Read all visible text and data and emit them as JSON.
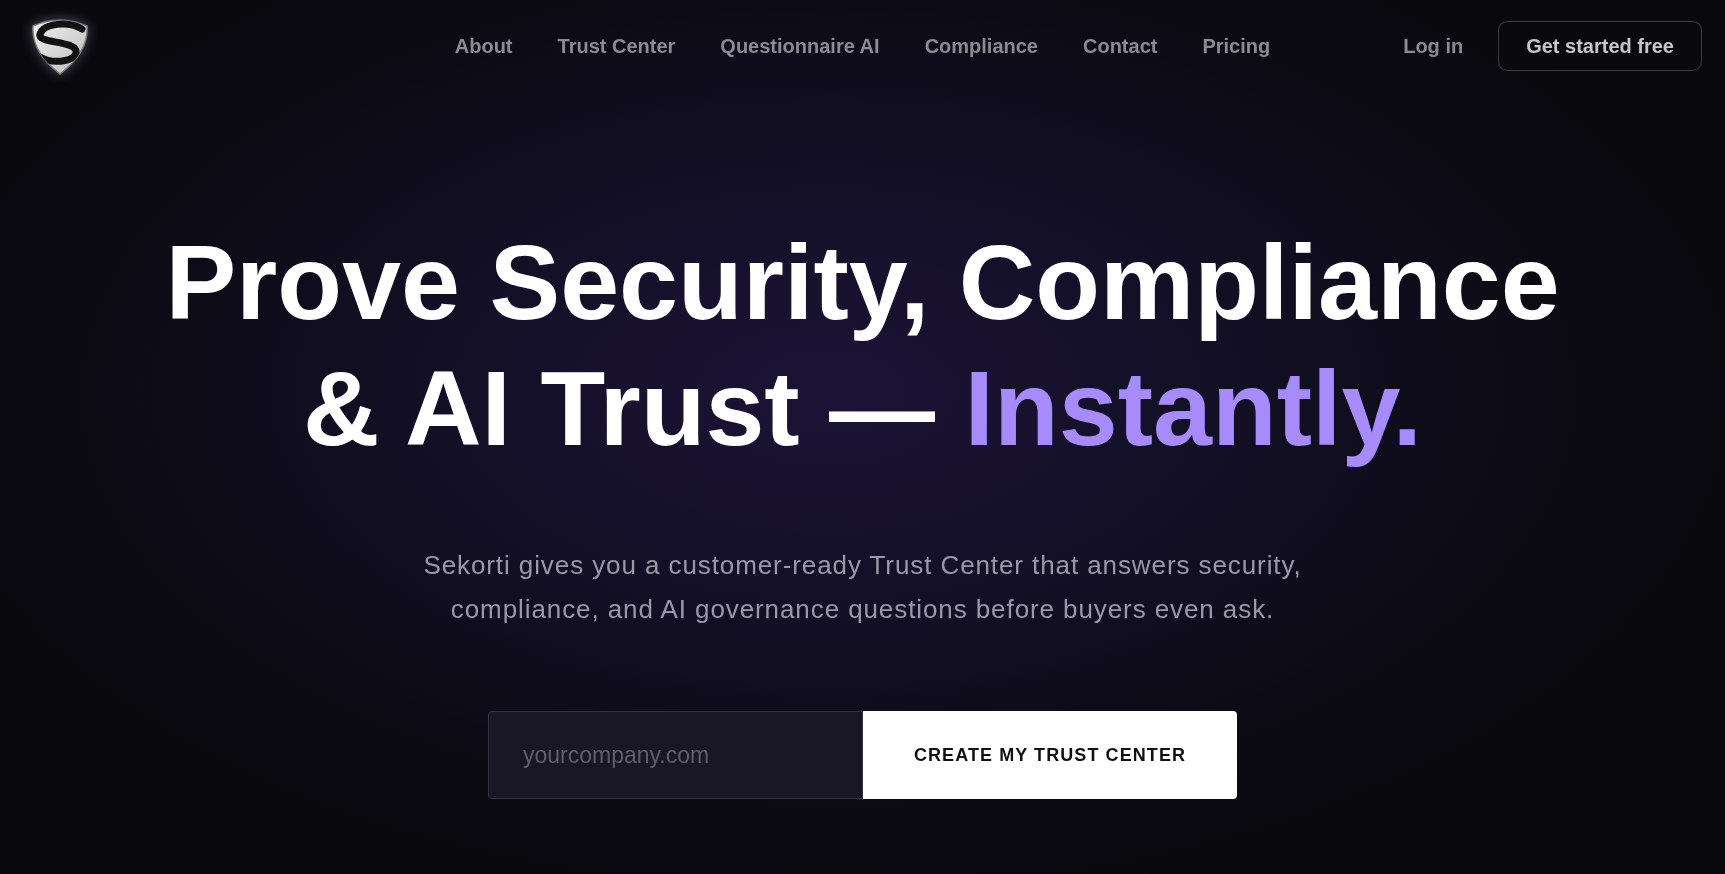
{
  "header": {
    "nav_links": [
      {
        "label": "About"
      },
      {
        "label": "Trust Center"
      },
      {
        "label": "Questionnaire AI"
      },
      {
        "label": "Compliance"
      },
      {
        "label": "Contact"
      },
      {
        "label": "Pricing"
      }
    ],
    "login": "Log in",
    "cta": "Get started free"
  },
  "hero": {
    "headline": [
      {
        "text": "Prove Security, Compliance & AI Trust —",
        "accent": false
      },
      {
        "text": "Instantly.",
        "accent": true
      }
    ],
    "subtitle": "Sekorti gives you a customer-ready Trust Center that answers security, compliance, and AI governance questions before buyers even ask.",
    "signup": {
      "placeholder": "yourcompany.com",
      "submit": "CREATE MY TRUST CENTER"
    }
  }
}
